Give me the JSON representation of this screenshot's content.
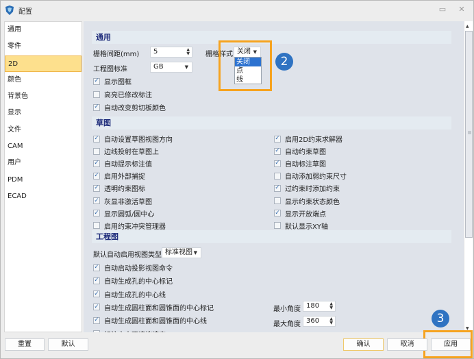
{
  "window": {
    "title": "配置",
    "icon": "app-logo-icon",
    "buttons": [
      "feedback-icon",
      "close-icon"
    ]
  },
  "sidebar": {
    "items": [
      {
        "label": "通用"
      },
      {
        "label": "零件"
      },
      {
        "label": "2D",
        "active": true
      },
      {
        "label": "颜色"
      },
      {
        "label": "背景色"
      },
      {
        "label": "显示"
      },
      {
        "label": "文件"
      },
      {
        "label": "CAM"
      },
      {
        "label": "用户"
      },
      {
        "label": "PDM"
      },
      {
        "label": "ECAD"
      }
    ]
  },
  "general": {
    "title": "通用",
    "grid_spacing_label": "栅格间距(mm)",
    "grid_spacing_value": "5",
    "grid_style_label": "栅格样式",
    "grid_style_value": "关闭",
    "grid_style_options": [
      "关闭",
      "点",
      "线"
    ],
    "drawing_standard_label": "工程图标准",
    "drawing_standard_value": "GB",
    "checkboxes": [
      {
        "label": "显示图框",
        "checked": true
      },
      {
        "label": "高亮已修改标注",
        "checked": false
      },
      {
        "label": "自动改变剪切板颜色",
        "checked": true
      }
    ]
  },
  "sketch": {
    "title": "草图",
    "left": [
      {
        "label": "自动设置草图视图方向",
        "checked": true
      },
      {
        "label": "边线投射在草图上",
        "checked": false
      },
      {
        "label": "自动提示标注值",
        "checked": true
      },
      {
        "label": "启用外部捕捉",
        "checked": true
      },
      {
        "label": "透明约束图标",
        "checked": true
      },
      {
        "label": "灰显非激活草图",
        "checked": true
      },
      {
        "label": "显示圆弧/圆中心",
        "checked": true
      },
      {
        "label": "启用约束冲突管理器",
        "checked": false
      }
    ],
    "right": [
      {
        "label": "启用2D约束求解器",
        "checked": true
      },
      {
        "label": "自动约束草图",
        "checked": true
      },
      {
        "label": "自动标注草图",
        "checked": true
      },
      {
        "label": "自动添加弱约束尺寸",
        "checked": false
      },
      {
        "label": "过约束时添加约束",
        "checked": true
      },
      {
        "label": "显示约束状态颜色",
        "checked": false
      },
      {
        "label": "显示开放端点",
        "checked": true
      },
      {
        "label": "默认显示XY轴",
        "checked": false
      }
    ]
  },
  "drawing": {
    "title": "工程图",
    "view_type_label": "默认自动启用视图类型",
    "view_type_value": "标准视图",
    "checkboxes": [
      {
        "label": "自动启动投影视图命令",
        "checked": true
      },
      {
        "label": "自动生成孔的中心标记",
        "checked": true
      },
      {
        "label": "自动生成孔的中心线",
        "checked": true
      },
      {
        "label": "自动生成圆柱面和圆锥面的中心标记",
        "checked": true
      },
      {
        "label": "自动生成圆柱面和圆锥面的中心线",
        "checked": true
      },
      {
        "label": "标注文本不遮挡填充",
        "checked": false
      }
    ],
    "min_angle_label": "最小角度",
    "min_angle_value": "180",
    "max_angle_label": "最大角度",
    "max_angle_value": "360"
  },
  "annotations": {
    "badge2": "2",
    "badge3": "3",
    "highlight_color": "#f6a31f",
    "badge_color": "#2f73c2"
  },
  "footer": {
    "reset_label": "重置",
    "default_label": "默认",
    "confirm_label": "确认",
    "cancel_label": "取消",
    "apply_label": "应用"
  }
}
